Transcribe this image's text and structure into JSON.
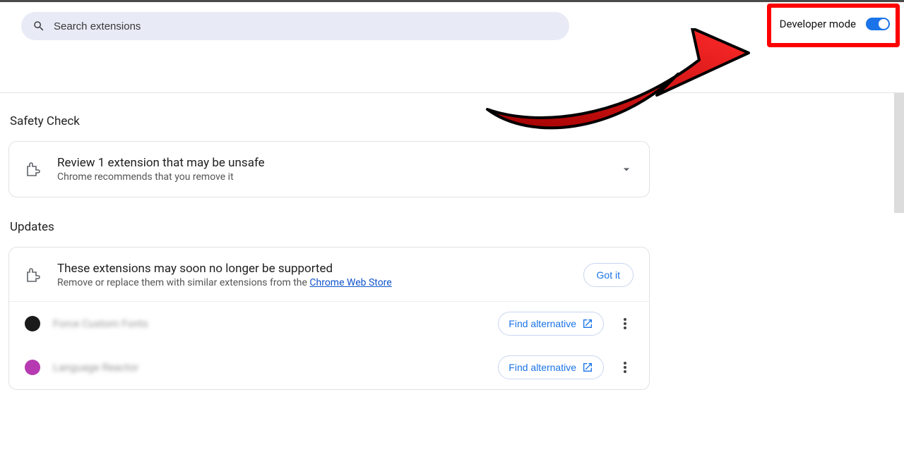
{
  "header": {
    "search_placeholder": "Search extensions",
    "developer_mode_label": "Developer mode",
    "developer_mode_on": true
  },
  "safety": {
    "section_title": "Safety Check",
    "title": "Review 1 extension that may be unsafe",
    "subtitle": "Chrome recommends that you remove it"
  },
  "updates": {
    "section_title": "Updates",
    "notice_title": "These extensions may soon no longer be supported",
    "notice_sub_prefix": "Remove or replace them with similar extensions from the ",
    "notice_link": "Chrome Web Store",
    "got_it_label": "Got it",
    "find_alt_label": "Find alternative",
    "items": [
      {
        "name": "Force Custom Fonts",
        "icon_color": "#1a1a1a"
      },
      {
        "name": "Language Reactor",
        "icon_color": "#b63ab1"
      }
    ]
  }
}
